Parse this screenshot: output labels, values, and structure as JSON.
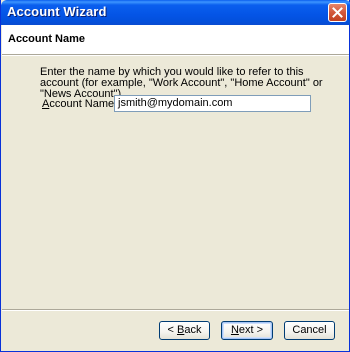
{
  "window": {
    "title": "Account Wizard"
  },
  "header": {
    "title": "Account Name"
  },
  "main": {
    "description": "Enter the name by which you would like to refer to this account (for example, \"Work Account\", \"Home Account\" or \"News Account\").",
    "account_name_label": "Account Name:",
    "account_name_value": "jsmith@mydomain.com"
  },
  "buttons": {
    "back": "< Back",
    "next": "Next >",
    "cancel": "Cancel"
  },
  "icons": {
    "close": "close-icon"
  },
  "colors": {
    "titlebar": "#0454e6",
    "dialog_bg": "#ece9d8",
    "close_button": "#d2583b"
  }
}
